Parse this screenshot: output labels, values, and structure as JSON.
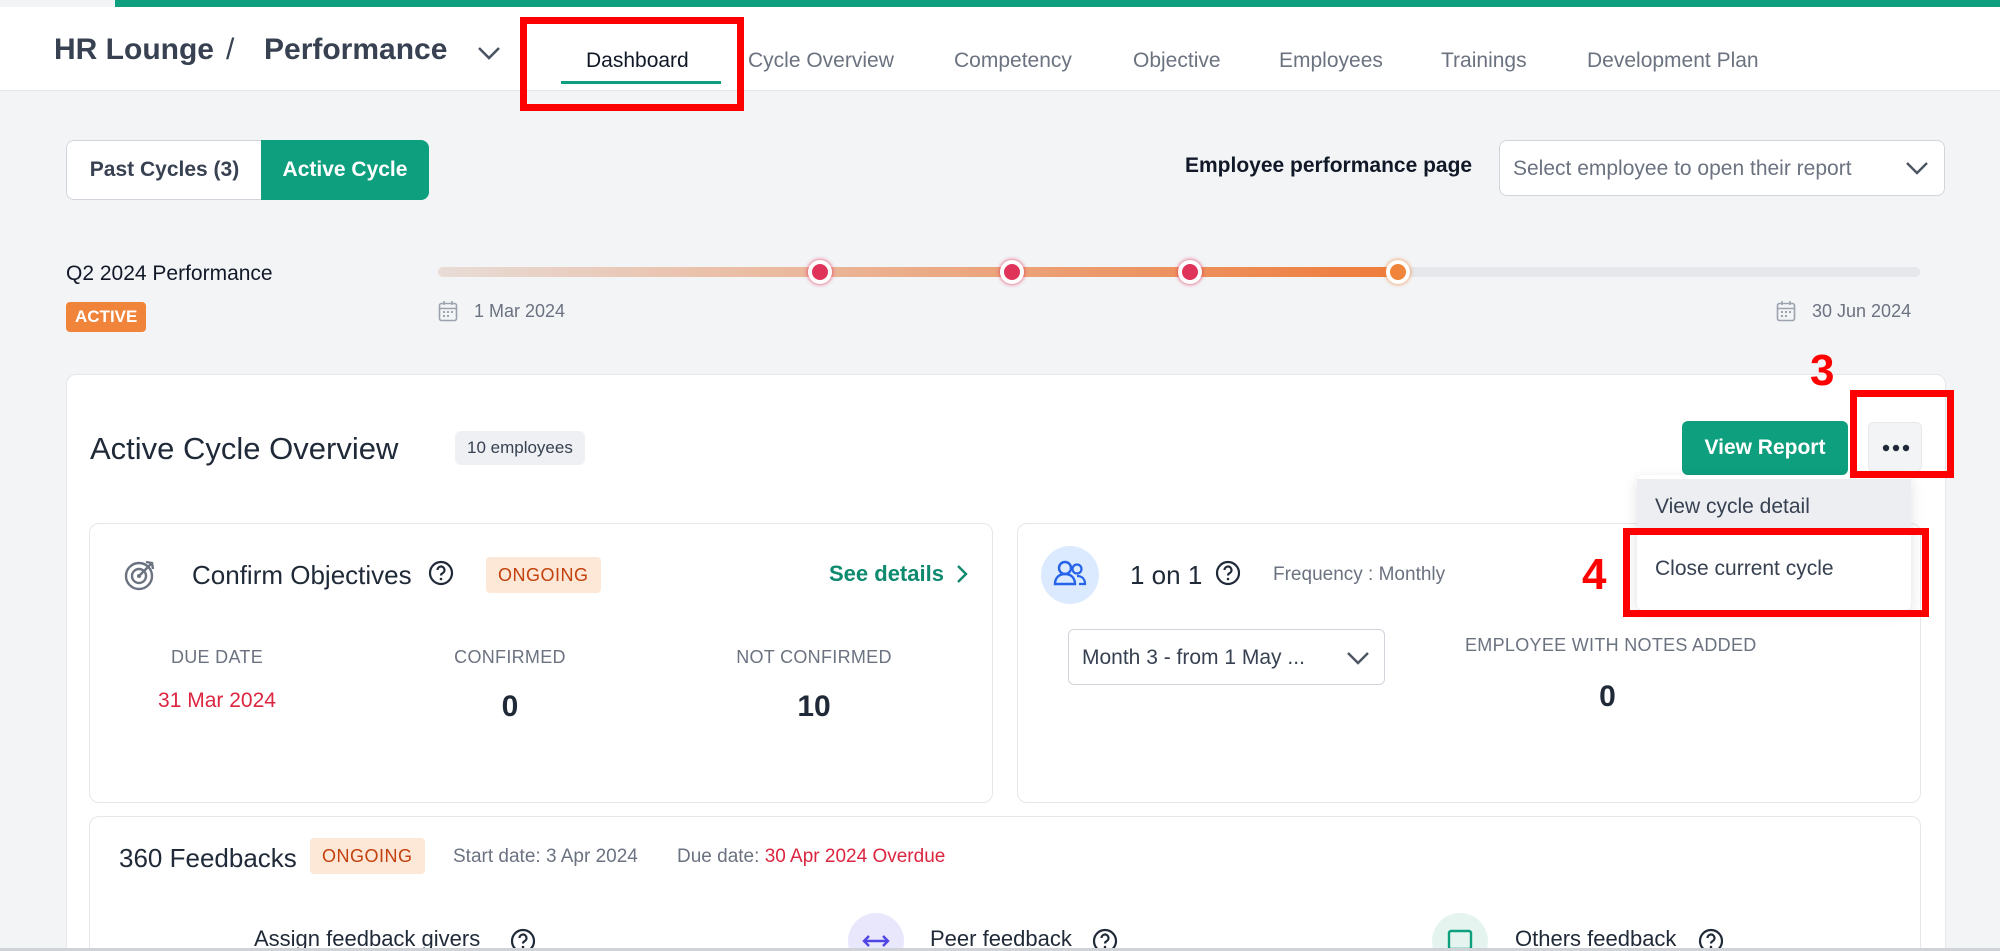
{
  "header": {
    "breadcrumb_home": "HR Lounge",
    "breadcrumb_sep": "/",
    "breadcrumb_current": "Performance",
    "tabs": [
      {
        "label": "Dashboard",
        "active": true
      },
      {
        "label": "Cycle Overview"
      },
      {
        "label": "Competency"
      },
      {
        "label": "Objective"
      },
      {
        "label": "Employees"
      },
      {
        "label": "Trainings"
      },
      {
        "label": "Development Plan"
      }
    ]
  },
  "cycle_toggle": {
    "past_label": "Past Cycles (3)",
    "active_label": "Active Cycle"
  },
  "employee_page": {
    "label": "Employee performance page",
    "placeholder": "Select employee to open their report"
  },
  "cycle": {
    "name": "Q2 2024 Performance",
    "status": "ACTIVE",
    "start_date": "1 Mar 2024",
    "end_date": "30 Jun 2024",
    "progress": 0.65
  },
  "overview": {
    "title": "Active Cycle Overview",
    "employee_count": "10 employees",
    "view_report": "View Report",
    "menu": {
      "item1": "View cycle detail",
      "item2": "Close current cycle"
    }
  },
  "annotations": {
    "step3": "3",
    "step4": "4"
  },
  "objectives": {
    "title": "Confirm Objectives",
    "status": "ONGOING",
    "see_details": "See details",
    "due_head": "DUE DATE",
    "due_value": "31 Mar 2024",
    "confirmed_head": "CONFIRMED",
    "confirmed_value": "0",
    "not_confirmed_head": "NOT CONFIRMED",
    "not_confirmed_value": "10"
  },
  "one_on_one": {
    "title": "1 on 1",
    "frequency": "Frequency : Monthly",
    "month_select": "Month 3 - from 1 May ...",
    "notes_head": "EMPLOYEE WITH NOTES ADDED",
    "notes_value": "0"
  },
  "feedback": {
    "title": "360 Feedbacks",
    "status": "ONGOING",
    "start": "Start date: 3 Apr 2024",
    "due_label": "Due date:",
    "due_value": "30 Apr 2024",
    "overdue": "Overdue",
    "assign": "Assign feedback givers",
    "peer": "Peer feedback",
    "others": "Others feedback"
  },
  "colors": {
    "brand": "#0e9f7e",
    "active_badge": "#f0843a",
    "timeline_dot": "#e0335a",
    "annotation": "#ff0000"
  }
}
